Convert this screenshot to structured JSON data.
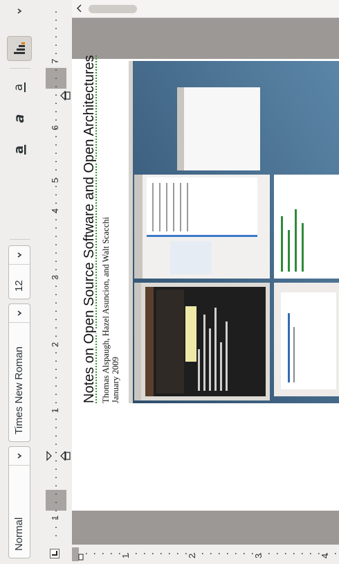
{
  "toolbar": {
    "paragraph_style": "Normal",
    "font_name": "Times New Roman",
    "font_size": "12"
  },
  "ruler": {
    "horizontal_labels": [
      "1",
      "1",
      "2",
      "3",
      "4",
      "5",
      "6",
      "7"
    ],
    "vertical_labels": [
      "1",
      "2",
      "3",
      "4"
    ]
  },
  "document": {
    "title": "Notes on Open Source Software and Open Architectures",
    "authors": "Thomas Alspaugh, Hazel Asuncion, and Walt Scacchi",
    "date": "January 2009"
  },
  "colors": {
    "accent": "#e57e14",
    "page": "#ffffff",
    "doc_background": "#9b9896"
  }
}
